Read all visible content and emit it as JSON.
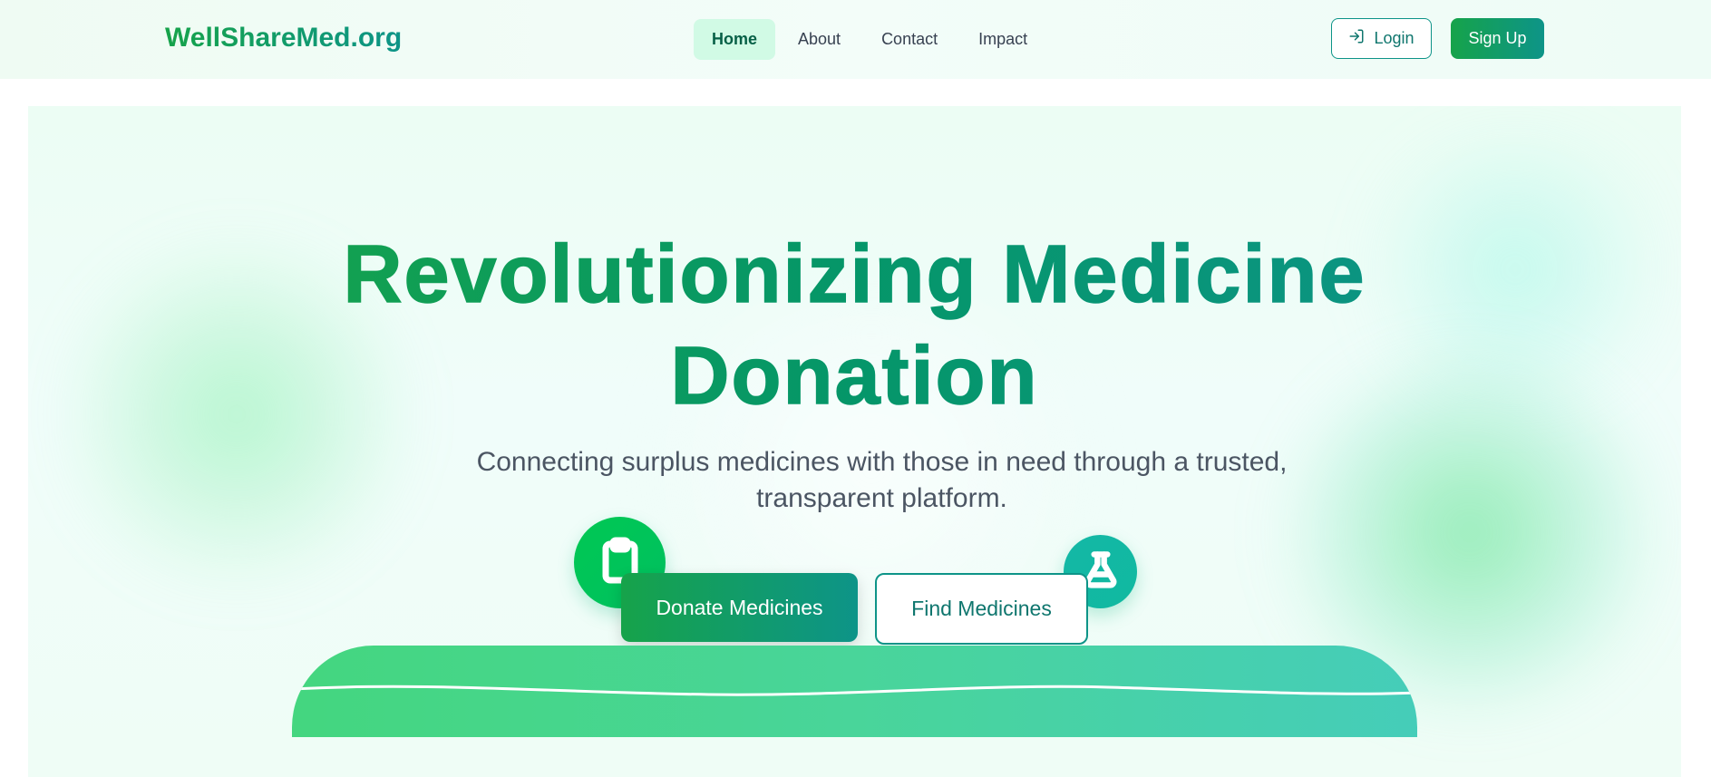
{
  "header": {
    "logo": "WellShareMed.org",
    "nav": [
      "Home",
      "About",
      "Contact",
      "Impact"
    ],
    "active_nav": "Home",
    "login_label": "Login",
    "signup_label": "Sign Up"
  },
  "hero": {
    "title_line1": "Revolutionizing Medicine",
    "title_line2": "Donation",
    "subtitle_line1": "Connecting surplus medicines with those in need through a trusted,",
    "subtitle_line2": "transparent platform.",
    "donate_label": "Donate Medicines",
    "find_label": "Find Medicines"
  },
  "icons": {
    "clipboard": "clipboard-icon",
    "flask": "flask-icon",
    "login": "login-arrow-icon"
  },
  "colors": {
    "brand_green": "#16a34a",
    "brand_teal": "#0d9488",
    "text_gray": "#4b5563",
    "nav_active_bg": "#d1fae5"
  }
}
